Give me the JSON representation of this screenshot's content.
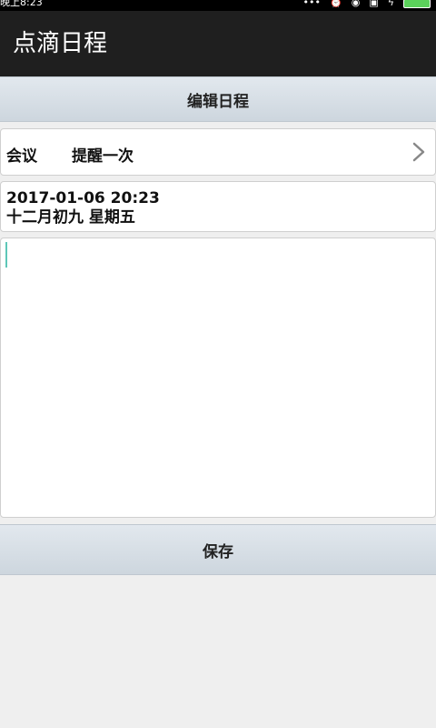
{
  "status_bar": {
    "time": "晚上8:23",
    "icons": [
      "more-icon",
      "alarm-icon",
      "wifi-icon",
      "sim-icon",
      "charging-icon",
      "battery-icon"
    ],
    "battery_color": "#5bd25b"
  },
  "app": {
    "title": "点滴日程"
  },
  "header": {
    "title": "编辑日程"
  },
  "event": {
    "type": "会议",
    "remind": "提醒一次",
    "date": "2017-01-06 20:23",
    "lunar": "十二月初九 星期五",
    "note": ""
  },
  "actions": {
    "save_label": "保存"
  },
  "colors": {
    "appbar": "#1f1f1f",
    "cursor": "#5ec7b8"
  }
}
